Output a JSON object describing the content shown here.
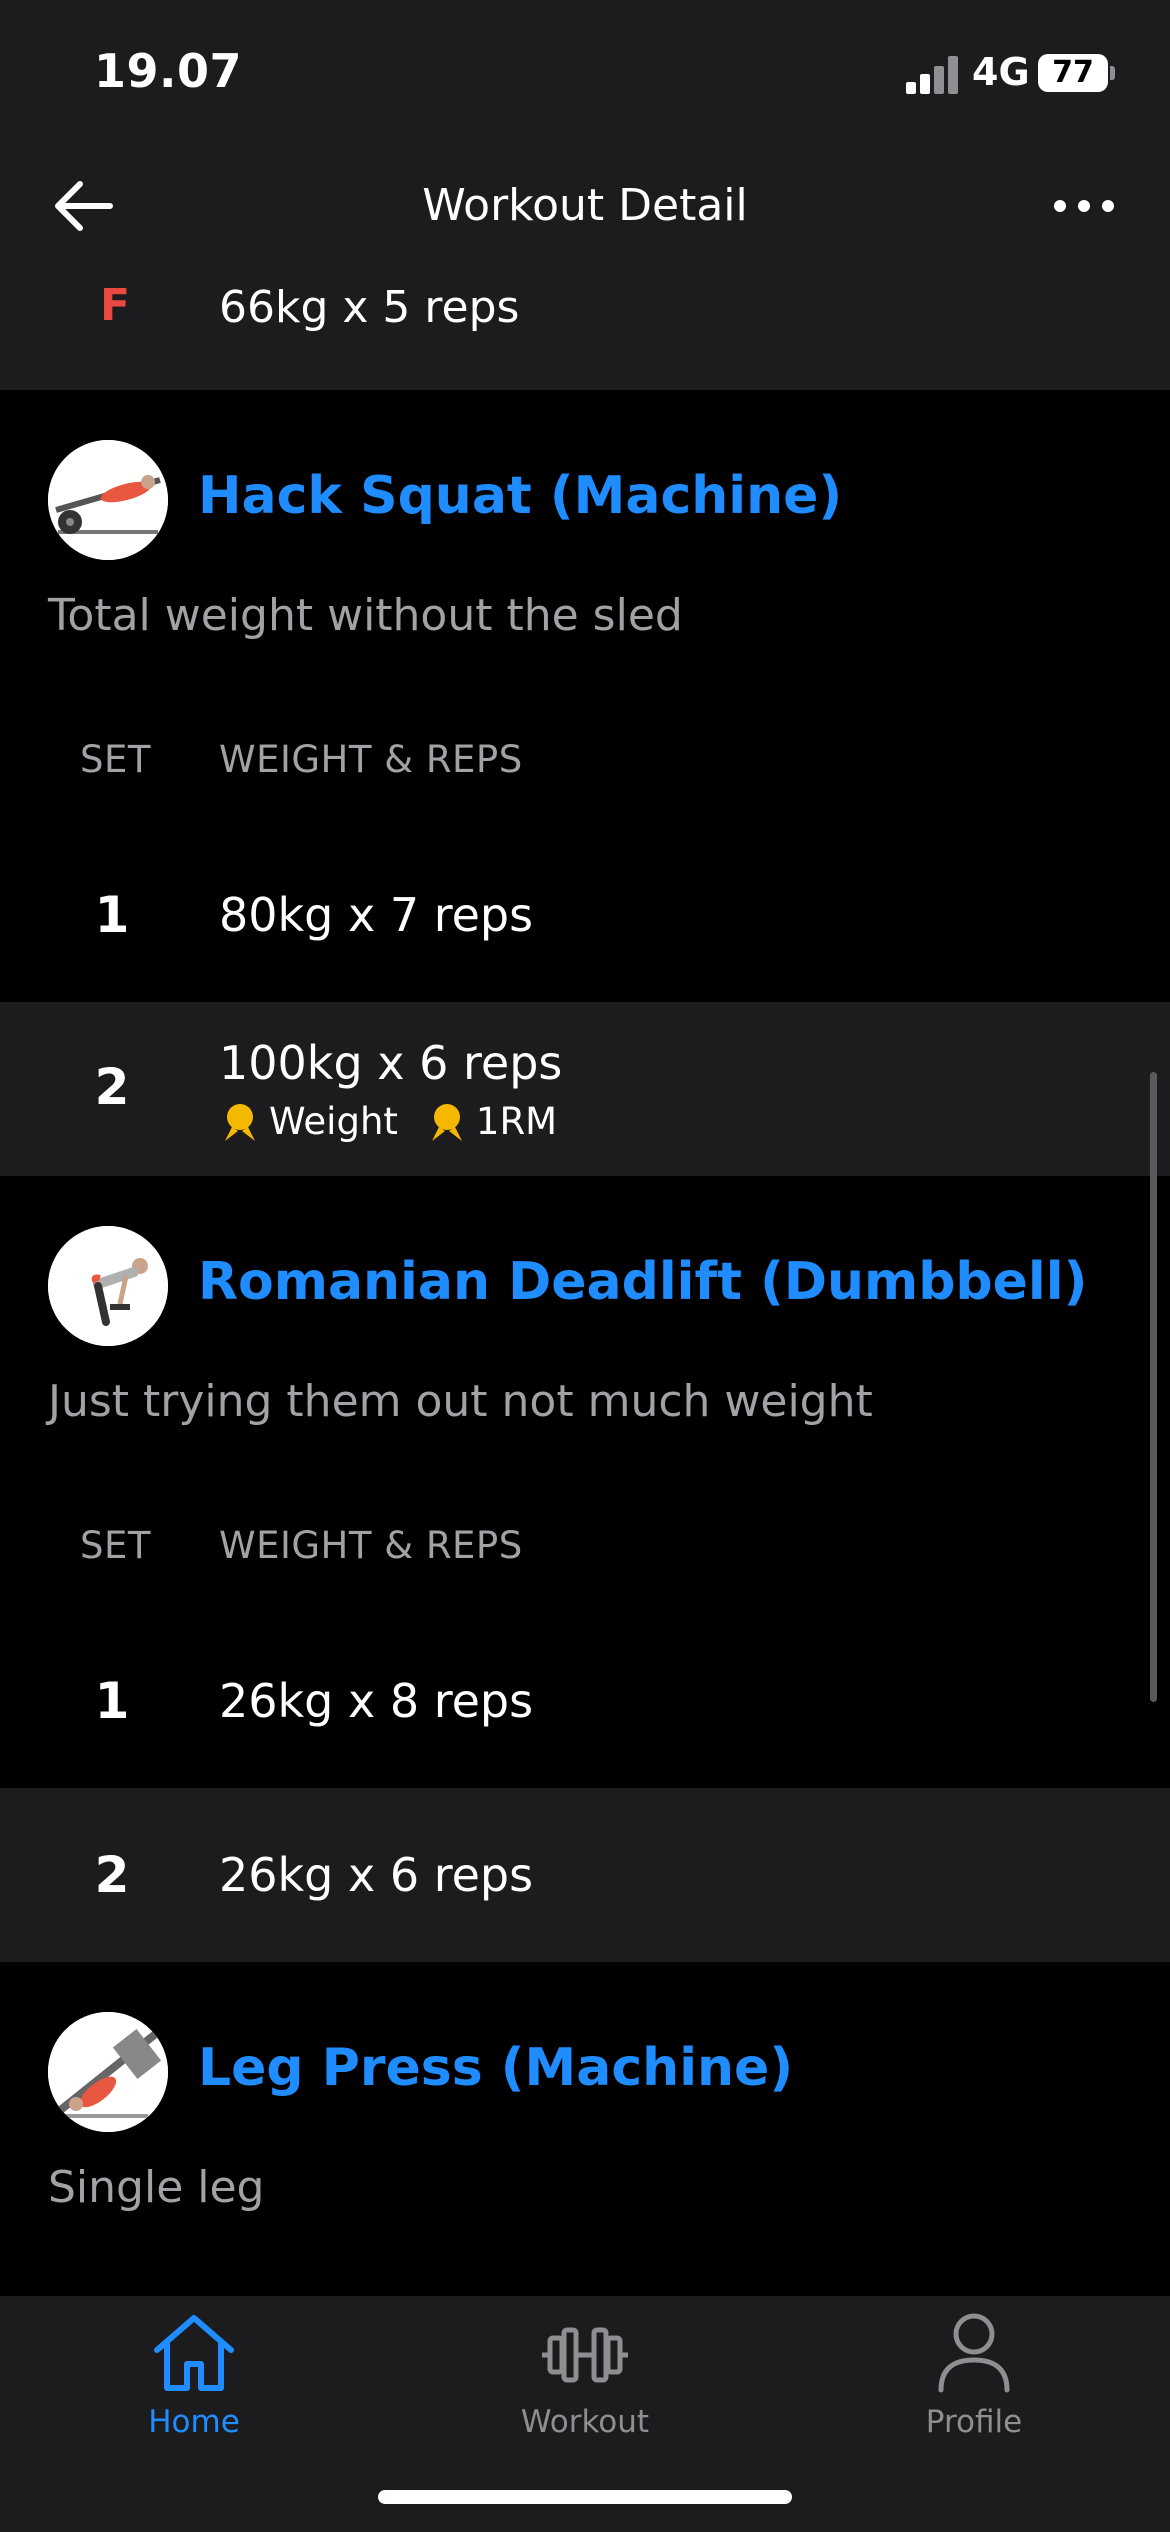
{
  "status_bar": {
    "time": "19.07",
    "network": "4G",
    "battery": "77"
  },
  "header": {
    "title": "Workout Detail"
  },
  "previous_set": {
    "set": "F",
    "weight_reps": "66kg x 5 reps"
  },
  "exercises": [
    {
      "name": "Hack Squat (Machine)",
      "note": "Total weight without the sled",
      "set_header": "SET",
      "wr_header": "WEIGHT & REPS",
      "sets": [
        {
          "set": "1",
          "weight_reps": "80kg x 7 reps"
        },
        {
          "set": "2",
          "weight_reps": "100kg x 6 reps",
          "badges": [
            "Weight",
            "1RM"
          ]
        }
      ]
    },
    {
      "name": "Romanian Deadlift (Dumbbell)",
      "note": "Just trying them out not much weight",
      "set_header": "SET",
      "wr_header": "WEIGHT & REPS",
      "sets": [
        {
          "set": "1",
          "weight_reps": "26kg x 8 reps"
        },
        {
          "set": "2",
          "weight_reps": "26kg x 6 reps"
        }
      ]
    },
    {
      "name": "Leg Press (Machine)",
      "note": "Single leg"
    }
  ],
  "tabbar": [
    {
      "label": "Home",
      "icon": "home-icon",
      "active": true
    },
    {
      "label": "Workout",
      "icon": "dumbbell-icon",
      "active": false
    },
    {
      "label": "Profile",
      "icon": "person-icon",
      "active": false
    }
  ],
  "colors": {
    "accent": "#1f8cff",
    "failure": "#e84a3f",
    "medal": "#f5b800"
  }
}
